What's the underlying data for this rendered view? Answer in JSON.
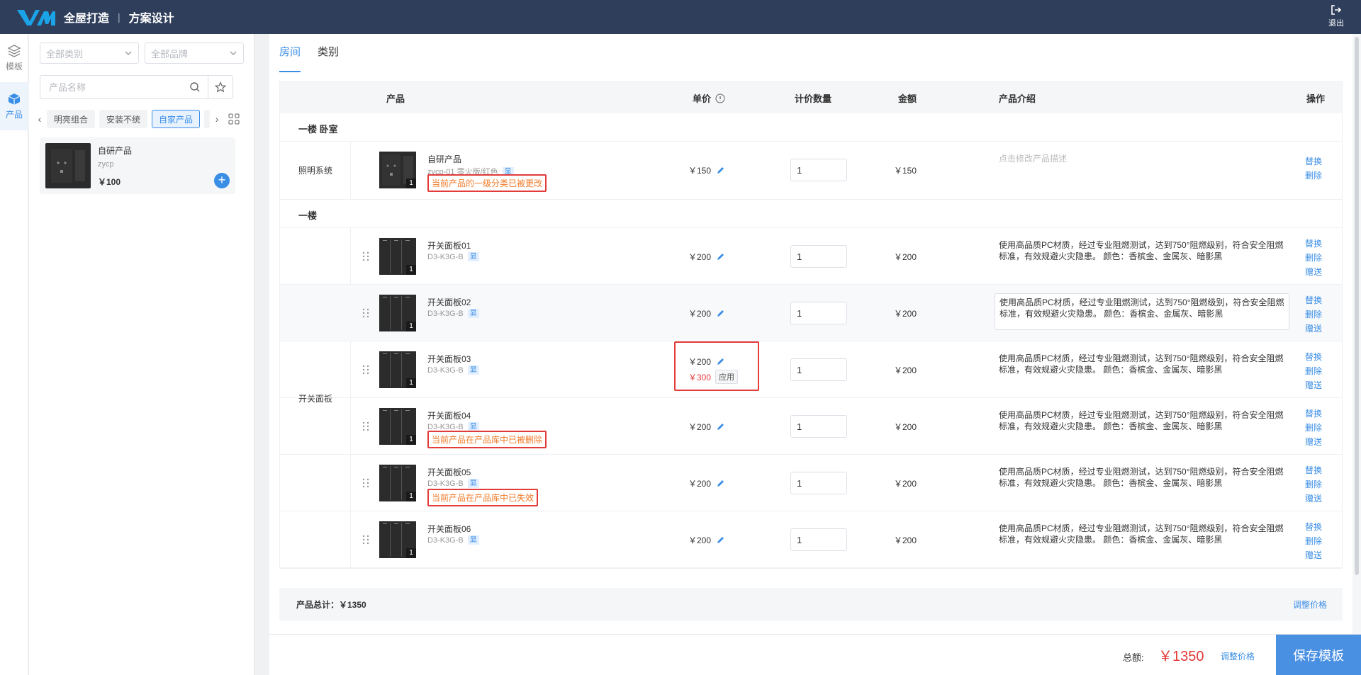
{
  "header": {
    "app_title": "全屋打造",
    "separator": "|",
    "page_title": "方案设计",
    "logout_label": "退出"
  },
  "rail": {
    "items": [
      {
        "label": "模板"
      },
      {
        "label": "产品"
      }
    ]
  },
  "panel": {
    "category_select": "全部类别",
    "brand_select": "全部品牌",
    "search_placeholder": "产品名称",
    "tags": [
      "明亮组合",
      "安装不统",
      "自家产品"
    ],
    "active_tag": "自家产品",
    "card": {
      "name": "自研产品",
      "code": "zycp",
      "price": "￥100"
    }
  },
  "main": {
    "tabs": [
      "房间",
      "类别"
    ],
    "columns": {
      "product": "产品",
      "unit_price": "单价",
      "qty": "计价数量",
      "amount": "金额",
      "intro": "产品介绍",
      "ops": "操作"
    },
    "groups": [
      {
        "title": "一楼 卧室",
        "category": "照明系统",
        "rows": [
          {
            "name": "自研产品",
            "code": "zycp-01 零火版/红色",
            "show": "显",
            "price": "￥150",
            "qty": "1",
            "amount": "￥150",
            "desc": "点击修改产品描述",
            "warn": "当前产品的一级分类已被更改",
            "ops": [
              "替换",
              "删除"
            ]
          }
        ]
      },
      {
        "title": "一楼",
        "category": "开关面板",
        "rows": [
          {
            "name": "开关面板01",
            "code": "D3-K3G-B",
            "show": "显",
            "price": "￥200",
            "qty": "1",
            "amount": "￥200",
            "desc": "使用高品质PC材质，经过专业阻燃测试，达到750°阻燃级别，符合安全阻燃标准，有效规避火灾隐患。 颜色：香槟金、金属灰、暗影黑",
            "ops": [
              "替换",
              "删除",
              "赠送"
            ]
          },
          {
            "name": "开关面板02",
            "code": "D3-K3G-B",
            "show": "显",
            "price": "￥200",
            "qty": "1",
            "amount": "￥200",
            "desc": "使用高品质PC材质，经过专业阻燃测试，达到750°阻燃级别，符合安全阻燃标准，有效规避火灾隐患。 颜色：香槟金、金属灰、暗影黑",
            "ops": [
              "替换",
              "删除",
              "赠送"
            ]
          },
          {
            "name": "开关面板03",
            "code": "D3-K3G-B",
            "show": "显",
            "price": "￥200",
            "new_price": "￥300",
            "apply": "应用",
            "qty": "1",
            "amount": "￥200",
            "desc": "使用高品质PC材质，经过专业阻燃测试，达到750°阻燃级别，符合安全阻燃标准，有效规避火灾隐患。 颜色：香槟金、金属灰、暗影黑",
            "ops": [
              "替换",
              "删除",
              "赠送"
            ]
          },
          {
            "name": "开关面板04",
            "code": "D3-K3G-B",
            "show": "显",
            "price": "￥200",
            "qty": "1",
            "amount": "￥200",
            "desc": "使用高品质PC材质，经过专业阻燃测试，达到750°阻燃级别，符合安全阻燃标准，有效规避火灾隐患。 颜色：香槟金、金属灰、暗影黑",
            "warn": "当前产品在产品库中已被删除",
            "ops": [
              "替换",
              "删除",
              "赠送"
            ]
          },
          {
            "name": "开关面板05",
            "code": "D3-K3G-B",
            "show": "显",
            "price": "￥200",
            "qty": "1",
            "amount": "￥200",
            "desc": "使用高品质PC材质，经过专业阻燃测试，达到750°阻燃级别，符合安全阻燃标准，有效规避火灾隐患。 颜色：香槟金、金属灰、暗影黑",
            "warn": "当前产品在产品库中已失效",
            "ops": [
              "替换",
              "删除",
              "赠送"
            ]
          },
          {
            "name": "开关面板06",
            "code": "D3-K3G-B",
            "show": "显",
            "price": "￥200",
            "qty": "1",
            "amount": "￥200",
            "desc": "使用高品质PC材质，经过专业阻燃测试，达到750°阻燃级别，符合安全阻燃标准，有效规避火灾隐患。 颜色：香槟金、金属灰、暗影黑",
            "ops": [
              "替换",
              "删除",
              "赠送"
            ]
          }
        ]
      }
    ],
    "summary": {
      "total_label": "产品总计：￥1350",
      "adjust": "调整价格"
    }
  },
  "bottom": {
    "total_label": "总额:",
    "total_value": "￥1350",
    "adjust": "调整价格",
    "save": "保存模板"
  },
  "colors": {
    "header_bg": "#2f3e5b",
    "accent": "#3a8ee6",
    "danger": "#e33a3a",
    "warn_text": "#f07a28"
  }
}
